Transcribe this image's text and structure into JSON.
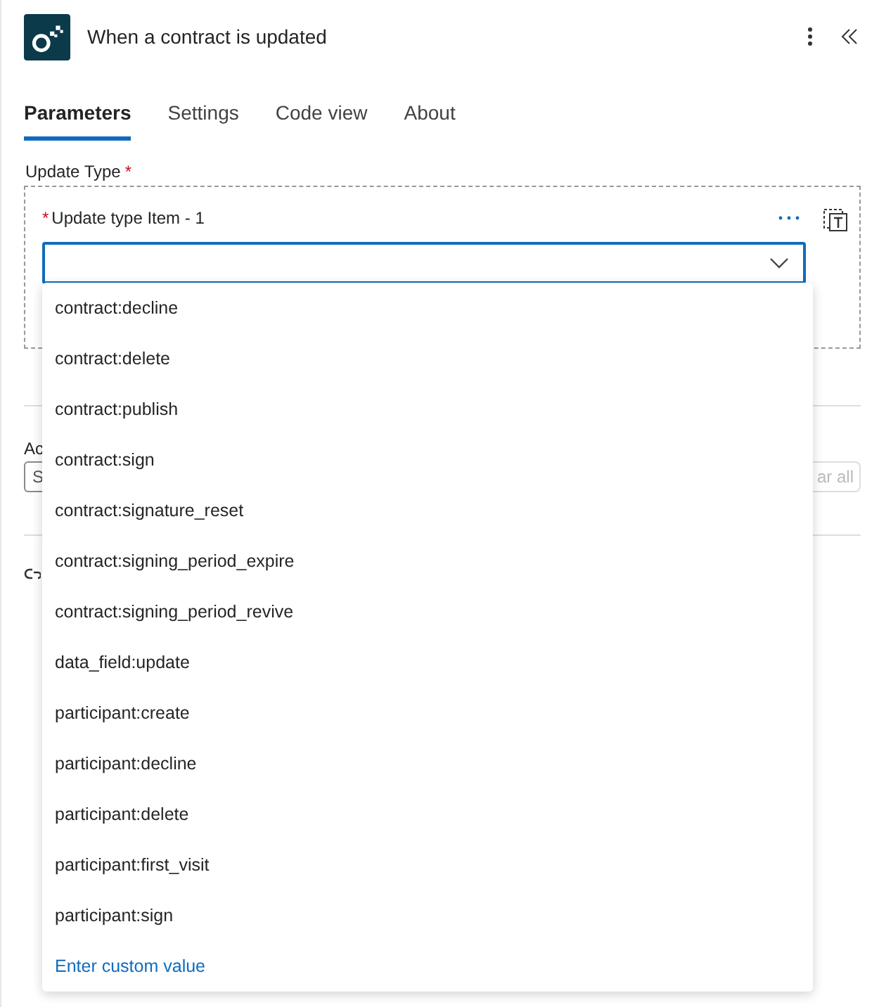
{
  "header": {
    "title": "When a contract is updated"
  },
  "tabs": [
    {
      "label": "Parameters",
      "selected": true
    },
    {
      "label": "Settings",
      "selected": false
    },
    {
      "label": "Code view",
      "selected": false
    },
    {
      "label": "About",
      "selected": false
    }
  ],
  "update_type": {
    "label": "Update Type",
    "required_mark": "*",
    "item": {
      "label": "Update type Item - 1",
      "required_mark": "*",
      "open": true
    }
  },
  "dropdown": {
    "options": [
      {
        "label": "contract:decline"
      },
      {
        "label": "contract:delete"
      },
      {
        "label": "contract:publish"
      },
      {
        "label": "contract:sign"
      },
      {
        "label": "contract:signature_reset"
      },
      {
        "label": "contract:signing_period_expire"
      },
      {
        "label": "contract:signing_period_revive"
      },
      {
        "label": "data_field:update"
      },
      {
        "label": "participant:create"
      },
      {
        "label": "participant:decline"
      },
      {
        "label": "participant:delete"
      },
      {
        "label": "participant:first_visit"
      },
      {
        "label": "participant:sign"
      }
    ],
    "custom_value": "Enter custom value"
  },
  "hidden_section": {
    "label": "Ac",
    "field_value": "S",
    "button": "ar all"
  }
}
